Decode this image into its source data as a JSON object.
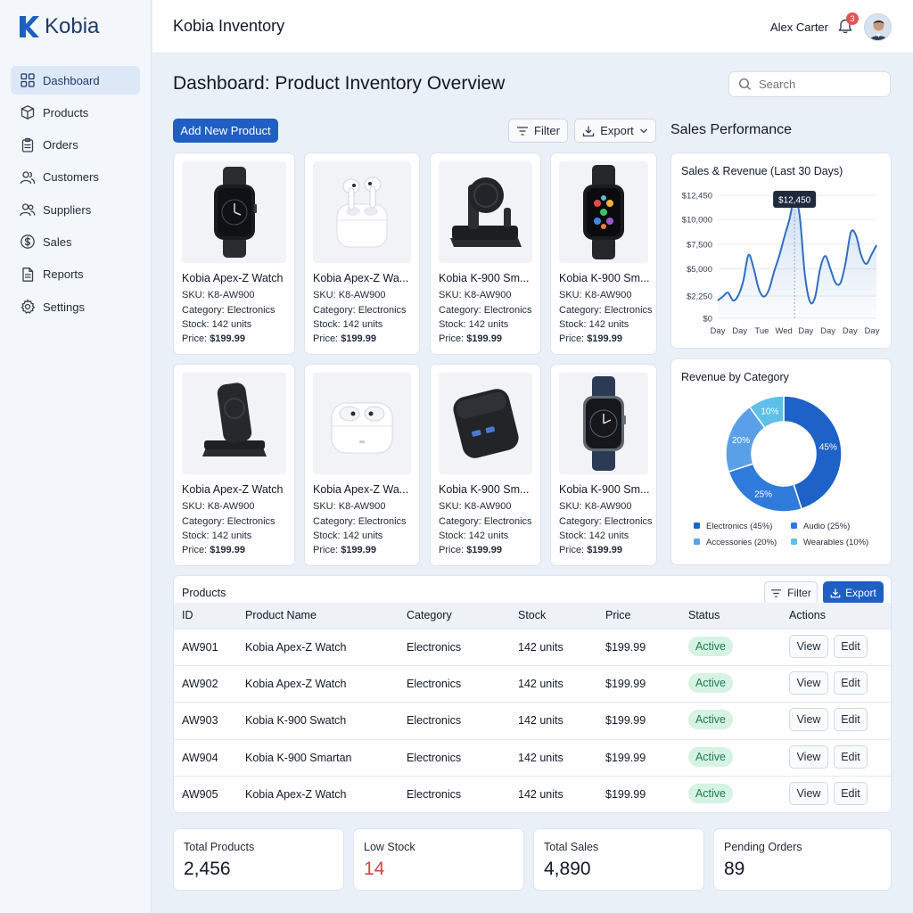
{
  "brand": {
    "name": "Kobia",
    "app_title": "Kobia Inventory"
  },
  "user": {
    "name": "Alex Carter",
    "notifications": "3"
  },
  "sidebar": {
    "items": [
      {
        "label": "Dashboard",
        "icon": "grid-icon",
        "active": true
      },
      {
        "label": "Products",
        "icon": "box-icon"
      },
      {
        "label": "Orders",
        "icon": "clipboard-icon"
      },
      {
        "label": "Customers",
        "icon": "users-icon"
      },
      {
        "label": "Suppliers",
        "icon": "supplier-icon"
      },
      {
        "label": "Sales",
        "icon": "dollar-icon"
      },
      {
        "label": "Reports",
        "icon": "report-icon"
      },
      {
        "label": "Settings",
        "icon": "gear-icon"
      }
    ]
  },
  "page": {
    "title": "Dashboard: Product Inventory Overview",
    "search_placeholder": "Search"
  },
  "toolbar": {
    "add_label": "Add New Product",
    "filter_label": "Filter",
    "export_label": "Export"
  },
  "sales_section": {
    "title": "Sales Performance"
  },
  "products": [
    {
      "name": "Kobia Apex-Z Watch",
      "sku": "SKU: K8-AW900",
      "category": "Category: Electronics",
      "stock": "Stock: 142 units",
      "price_label": "Price: ",
      "price": "$199.99",
      "image": "smartwatch-dark"
    },
    {
      "name": "Kobia Apex-Z Wa...",
      "sku": "SKU: K8-AW900",
      "category": "Category: Electronics",
      "stock": "Stock: 142 units",
      "price_label": "Price: ",
      "price": "$199.99",
      "image": "earbuds-open"
    },
    {
      "name": "Kobia K-900 Sm...",
      "sku": "SKU: K8-AW900",
      "category": "Category: Electronics",
      "stock": "Stock: 142 units",
      "price_label": "Price: ",
      "price": "$199.99",
      "image": "charging-stand"
    },
    {
      "name": "Kobia K-900 Sm...",
      "sku": "SKU: K8-AW900",
      "category": "Category: Electronics",
      "stock": "Stock: 142 units",
      "price_label": "Price: ",
      "price": "$199.99",
      "image": "smartwatch-apps"
    },
    {
      "name": "Kobia Apex-Z Watch",
      "sku": "SKU: K8-AW900",
      "category": "Category: Electronics",
      "stock": "Stock: 142 units",
      "price_label": "Price: ",
      "price": "$199.99",
      "image": "wireless-charger"
    },
    {
      "name": "Kobia Apex-Z Wa...",
      "sku": "SKU: K8-AW900",
      "category": "Category: Electronics",
      "stock": "Stock: 142 units",
      "price_label": "Price: ",
      "price": "$199.99",
      "image": "earbuds-case"
    },
    {
      "name": "Kobia K-900 Sm...",
      "sku": "SKU: K8-AW900",
      "category": "Category: Electronics",
      "stock": "Stock: 142 units",
      "price_label": "Price: ",
      "price": "$199.99",
      "image": "power-adapter"
    },
    {
      "name": "Kobia K-900 Sm...",
      "sku": "SKU: K8-AW900",
      "category": "Category: Electronics",
      "stock": "Stock: 142 units",
      "price_label": "Price: ",
      "price": "$199.99",
      "image": "smartwatch-navy"
    }
  ],
  "table": {
    "title": "Products",
    "filter_label": "Filter",
    "export_label": "Export",
    "columns": [
      "ID",
      "Product Name",
      "Category",
      "Stock",
      "Price",
      "Status",
      "Actions"
    ],
    "view_label": "View",
    "edit_label": "Edit",
    "rows": [
      {
        "id": "AW901",
        "name": "Kobia Apex-Z Watch",
        "category": "Electronics",
        "stock": "142 units",
        "price": "$199.99",
        "status": "Active"
      },
      {
        "id": "AW902",
        "name": "Kobia Apex-Z Watch",
        "category": "Electronics",
        "stock": "142 units",
        "price": "$199.99",
        "status": "Active"
      },
      {
        "id": "AW903",
        "name": "Kobia K-900 Swatch",
        "category": "Electronics",
        "stock": "142 units",
        "price": "$199.99",
        "status": "Active"
      },
      {
        "id": "AW904",
        "name": "Kobia K-900 Smartan",
        "category": "Electronics",
        "stock": "142 units",
        "price": "$199.99",
        "status": "Active"
      },
      {
        "id": "AW905",
        "name": "Kobia Apex-Z Watch",
        "category": "Electronics",
        "stock": "142 units",
        "price": "$199.99",
        "status": "Active"
      }
    ]
  },
  "stats": [
    {
      "label": "Total Products",
      "value": "2,456",
      "color": "#111827"
    },
    {
      "label": "Low Stock",
      "value": "14",
      "color": "#d64545"
    },
    {
      "label": "Total Sales",
      "value": "4,890",
      "color": "#111827"
    },
    {
      "label": "Pending Orders",
      "value": "89",
      "color": "#111827"
    }
  ],
  "colors": {
    "accent": "#1f5fc4",
    "status_active_bg": "#d5f2e3",
    "status_active_text": "#1f7a4f",
    "low_stock": "#d64545"
  },
  "chart_data": [
    {
      "type": "area",
      "title": "Sales & Revenue (Last 30 Days)",
      "x": [
        "Day",
        "Day",
        "Tue",
        "Wed",
        "Day",
        "Day",
        "Day",
        "Day"
      ],
      "ylim": [
        0,
        12450
      ],
      "yticks": [
        "$0",
        "$2,250",
        "$5,000",
        "$7,500",
        "$10,000",
        "$12,450"
      ],
      "ytick_values": [
        0,
        2250,
        5000,
        7500,
        10000,
        12450
      ],
      "series": [
        {
          "values": [
            1800,
            2200,
            2600,
            1800,
            2300,
            3800,
            6400,
            5100,
            3000,
            2200,
            2900,
            4700,
            6300,
            8200,
            10000,
            12100,
            10400,
            4500,
            1700,
            2100,
            5000,
            6300,
            5000,
            3600,
            3600,
            5700,
            8700,
            8400,
            6400,
            5500,
            6400,
            7400
          ]
        }
      ],
      "tooltip": "$12,450",
      "tooltip_index": 15,
      "color": "#2f6ec2",
      "grid": true
    },
    {
      "type": "pie",
      "title": "Revenue by Category",
      "donut": true,
      "labels": [
        "Electronics (45%)",
        "Audio (25%)",
        "Accessories (20%)",
        "Wearables (10%)"
      ],
      "slice_labels": [
        "45%",
        "25%",
        "20%",
        "10%"
      ],
      "values": [
        45,
        25,
        20,
        10
      ],
      "colors": [
        "#1e62c8",
        "#2f7bdc",
        "#5aa0e8",
        "#5ec0e8"
      ],
      "legend": "bottom"
    }
  ]
}
